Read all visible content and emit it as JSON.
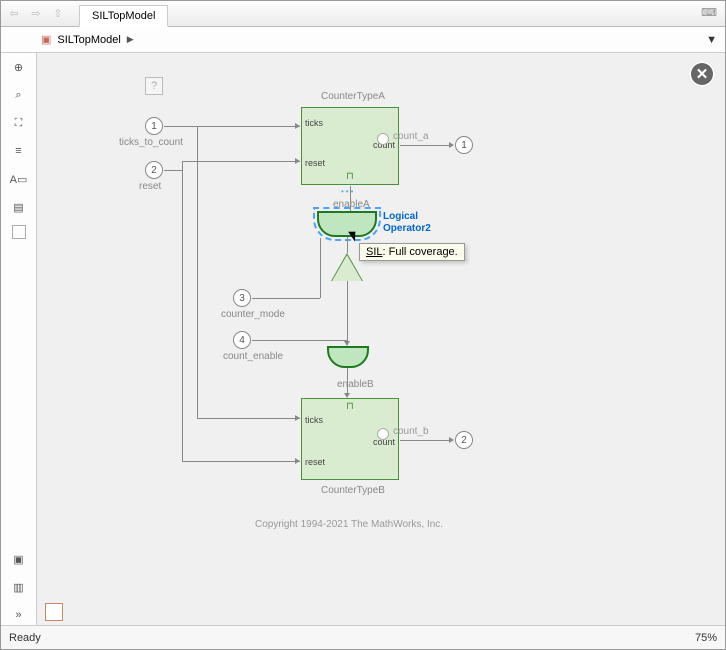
{
  "toolbar": {
    "tab_title": "SILTopModel"
  },
  "explorer": {
    "icon": "model-icon",
    "crumb": "SILTopModel"
  },
  "status": {
    "ready": "Ready",
    "zoom": "75%"
  },
  "canvas": {
    "copyright": "Copyright 1994-2021 The MathWorks, Inc.",
    "qmark": "?",
    "close_btn": "✕",
    "tooltip_text": "SIL: Full coverage.",
    "inports": {
      "ticks_to_count": {
        "num": "1",
        "label": "ticks_to_count"
      },
      "reset": {
        "num": "2",
        "label": "reset"
      },
      "counter_mode": {
        "num": "3",
        "label": "counter_mode"
      },
      "count_enable": {
        "num": "4",
        "label": "count_enable"
      }
    },
    "counterA": {
      "label": "CounterTypeA",
      "port_ticks": "ticks",
      "port_reset": "reset",
      "port_count": "count"
    },
    "counterB": {
      "label": "CounterTypeB",
      "port_ticks": "ticks",
      "port_reset": "reset",
      "port_count": "count"
    },
    "logical": {
      "name": "Logical Operator2",
      "enableA_label": "enableA",
      "enableB_label": "enableB"
    },
    "outports": {
      "count_a": {
        "num": "1",
        "label": "count_a"
      },
      "count_b": {
        "num": "2",
        "label": "count_b"
      }
    }
  }
}
